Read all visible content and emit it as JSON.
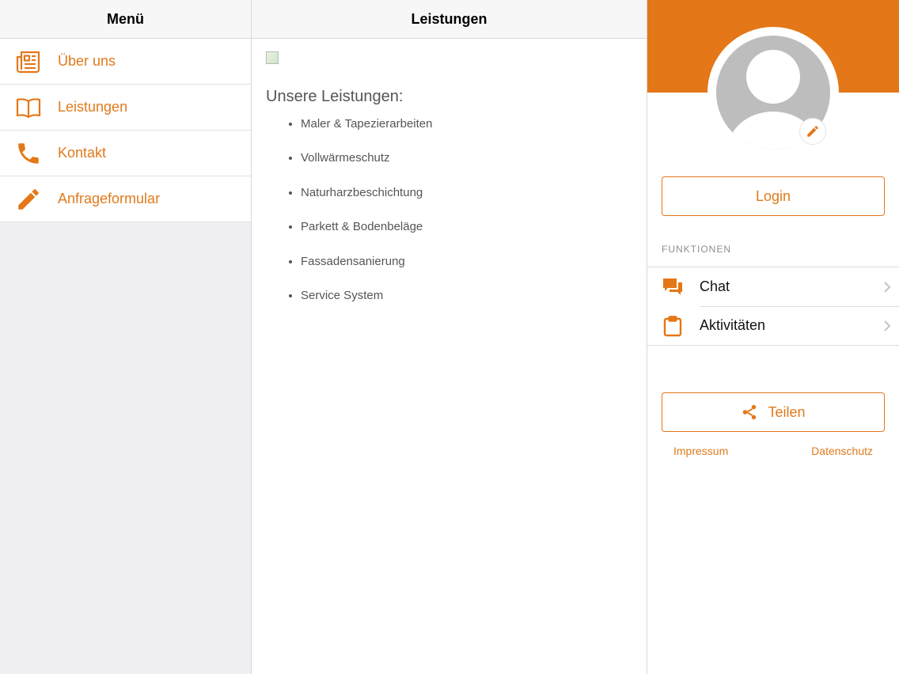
{
  "menu": {
    "title": "Menü",
    "items": [
      {
        "label": "Über uns",
        "icon": "newspaper-icon"
      },
      {
        "label": "Leistungen",
        "icon": "book-icon"
      },
      {
        "label": "Kontakt",
        "icon": "phone-icon"
      },
      {
        "label": "Anfrageformular",
        "icon": "pencil-icon"
      }
    ]
  },
  "content": {
    "title": "Leistungen",
    "heading": "Unsere Leistungen:",
    "services": [
      "Maler & Tapezierarbeiten",
      "Vollwärmeschutz",
      "Naturharzbeschichtung",
      "Parkett & Bodenbeläge",
      "Fassadensanierung",
      "Service System"
    ]
  },
  "profile": {
    "login_label": "Login",
    "section_label": "FUNKTIONEN",
    "functions": [
      {
        "label": "Chat",
        "icon": "chat-icon"
      },
      {
        "label": "Aktivitäten",
        "icon": "clipboard-icon"
      }
    ],
    "share_label": "Teilen",
    "impressum_label": "Impressum",
    "datenschutz_label": "Datenschutz"
  },
  "colors": {
    "accent": "#e47717",
    "menu_background": "#efeff4"
  }
}
